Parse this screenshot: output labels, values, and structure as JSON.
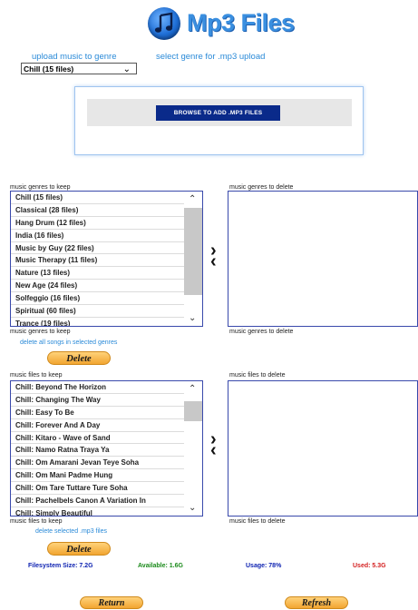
{
  "header": {
    "title": "Mp3 Files"
  },
  "upload": {
    "genre_label": "upload music to genre",
    "select_label": "select genre for .mp3 upload",
    "selected_genre": "Chill (15 files)",
    "browse_label": "BROWSE TO ADD .MP3 FILES"
  },
  "genres": {
    "keep_label_top": "music genres to keep",
    "delete_label_top": "music genres to delete",
    "keep_label_bottom": "music genres to keep",
    "delete_label_bottom": "music genres to delete",
    "delete_all_label": "delete all songs in selected genres",
    "delete_button": "Delete",
    "items": [
      "Chill (15 files)",
      "Classical (28 files)",
      "Hang Drum (12 files)",
      "India (16 files)",
      "Music by Guy (22 files)",
      "Music Therapy (11 files)",
      "Nature (13 files)",
      "New Age (24 files)",
      "Solfeggio (16 files)",
      "Spiritual (60 files)",
      "Trance (19 files)"
    ]
  },
  "files": {
    "keep_label_top": "music files to keep",
    "delete_label_top": "music files to delete",
    "keep_label_bottom": "music files to keep",
    "delete_label_bottom": "music files to delete",
    "delete_selected_label": "delete selected .mp3 files",
    "delete_button": "Delete",
    "items": [
      "Chill: Beyond The Horizon",
      "Chill: Changing The Way",
      "Chill: Easy To Be",
      "Chill: Forever And A Day",
      "Chill: Kitaro - Wave of Sand",
      "Chill: Namo Ratna Traya Ya",
      "Chill: Om Amarani Jevan Teye Soha",
      "Chill: Om Mani Padme Hung",
      "Chill: Om Tare Tuttare Ture Soha",
      "Chill: Pachelbels Canon A Variation In",
      "Chill: Simply Beautiful"
    ]
  },
  "stats": {
    "filesystem": "Filesystem Size: 7.2G",
    "available": "Available: 1.6G",
    "usage": "Usage: 78%",
    "used": "Used: 5.3G"
  },
  "nav": {
    "return_label": "Return",
    "refresh_label": "Refresh"
  },
  "colors": {
    "accent_blue": "#2a8ad8",
    "navy": "#0a2a8a",
    "stat_blue": "#0a1fb0",
    "stat_green": "#1a8a1a",
    "stat_red": "#d42020",
    "button_orange": "#f2a531"
  }
}
